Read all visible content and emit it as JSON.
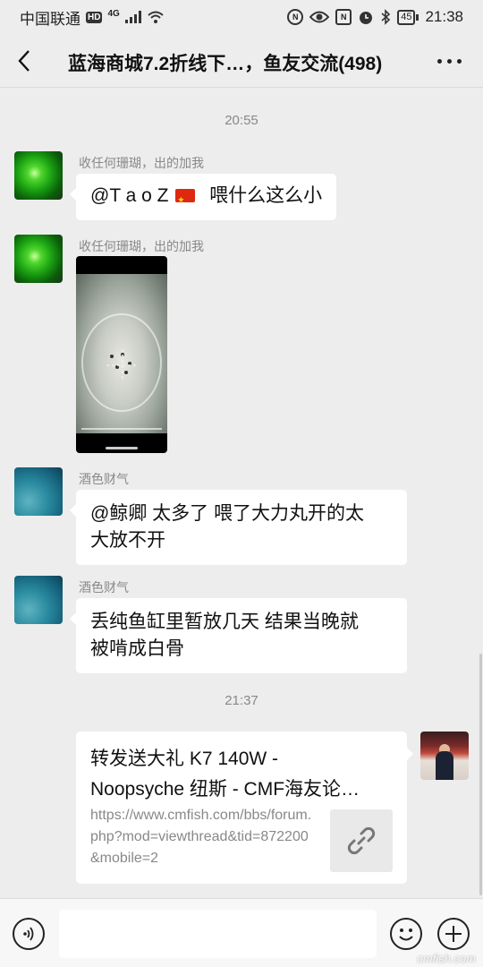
{
  "status_bar": {
    "carrier": "中国联通",
    "hd_label": "HD",
    "network": "4G",
    "battery": "45",
    "time": "21:38"
  },
  "title_bar": {
    "title": "蓝海商城7.2折线下…，鱼友交流(498)"
  },
  "messages": [
    {
      "time": "20:55"
    },
    {
      "sender": "收任何珊瑚，出的加我",
      "mention": "@T a o Z",
      "text": "喂什么这么小"
    },
    {
      "sender": "收任何珊瑚，出的加我",
      "type": "video"
    },
    {
      "sender": "酒色财气",
      "text_line1": "@鲸卿  太多了  喂了大力丸开的太",
      "text_line2": "大放不开"
    },
    {
      "sender": "酒色财气",
      "text_line1": "丢纯鱼缸里暂放几天  结果当晚就",
      "text_line2": "被啃成白骨"
    },
    {
      "time": "21:37"
    },
    {
      "type": "link",
      "title_line1": "转发送大礼 K7 140W -",
      "title_line2": "Noopsyche 纽斯 - CMF海友论…",
      "url": "https://www.cmfish.com/bbs/forum.php?mod=viewthread&tid=872200&mobile=2"
    }
  ],
  "input_bar": {
    "placeholder": ""
  },
  "watermark": "cmfish.com",
  "colors": {
    "background": "#ededed",
    "bubble": "#ffffff",
    "time_text": "#888888"
  }
}
